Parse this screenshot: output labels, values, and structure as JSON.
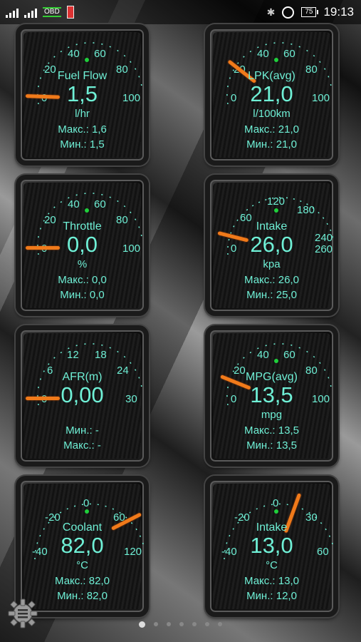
{
  "statusbar": {
    "obd_label": "OBD",
    "battery": "75",
    "time": "19:13",
    "icons": [
      "signal-1-icon",
      "signal-2-icon",
      "obd-icon",
      "app-notification-icon",
      "bluetooth-icon",
      "alarm-icon",
      "battery-icon"
    ]
  },
  "colors": {
    "accent": "#6ff0d6",
    "needle": "#f07a1a",
    "pivot": "#1fcf3b"
  },
  "gauges": [
    {
      "name": "Fuel Flow",
      "value": "1,5",
      "unit": "l/hr",
      "ticks": [
        "0",
        "20",
        "40",
        "60",
        "80",
        "100"
      ],
      "stat1": "Макс.: 1,6",
      "stat2": "Мин.: 1,5"
    },
    {
      "name": "LPK(avg)",
      "value": "21,0",
      "unit": "l/100km",
      "ticks": [
        "0",
        "20",
        "40",
        "60",
        "80",
        "100"
      ],
      "stat1": "Макс.: 21,0",
      "stat2": "Мин.: 21,0"
    },
    {
      "name": "Throttle",
      "value": "0,0",
      "unit": "%",
      "ticks": [
        "0",
        "20",
        "40",
        "60",
        "80",
        "100"
      ],
      "stat1": "Макс.: 0,0",
      "stat2": "Мин.: 0,0"
    },
    {
      "name": "Intake",
      "value": "26,0",
      "unit": "kpa",
      "ticks": [
        "0",
        "60",
        "120",
        "180",
        "240",
        "260"
      ],
      "stat1": "Макс.: 26,0",
      "stat2": "Мин.: 25,0"
    },
    {
      "name": "AFR(m)",
      "value": "0,00",
      "unit": "",
      "ticks": [
        "0",
        "6",
        "12",
        "18",
        "24",
        "30"
      ],
      "stat1": "Мин.: -",
      "stat2": "Макс.: -"
    },
    {
      "name": "MPG(avg)",
      "value": "13,5",
      "unit": "mpg",
      "ticks": [
        "0",
        "20",
        "40",
        "60",
        "80",
        "100"
      ],
      "stat1": "Макс.: 13,5",
      "stat2": "Мин.: 13,5"
    },
    {
      "name": "Coolant",
      "value": "82,0",
      "unit": "°C",
      "ticks": [
        "-40",
        "-20",
        "0",
        "60",
        "120"
      ],
      "stat1": "Макс.: 82,0",
      "stat2": "Мин.: 82,0"
    },
    {
      "name": "Intake",
      "value": "13,0",
      "unit": "°C",
      "ticks": [
        "-40",
        "-20",
        "0",
        "30",
        "60"
      ],
      "stat1": "Макс.: 13,0",
      "stat2": "Мин.: 12,0"
    }
  ],
  "pager": {
    "page_count": 7,
    "active_page": 0
  }
}
